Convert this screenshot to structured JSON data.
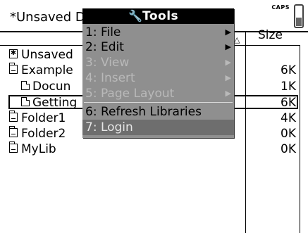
{
  "window": {
    "doc_title": "*Unsaved D",
    "caps_indicator": "CAPS"
  },
  "columns": {
    "size_header": "Size",
    "sort_indicator": "△"
  },
  "files": [
    {
      "name": "Unsaved",
      "size": "",
      "icon": "unsaved-doc-icon"
    },
    {
      "name": "Example",
      "size": "6K",
      "icon": "folder-open-icon"
    },
    {
      "name": "Docun",
      "size": "1K",
      "icon": "document-icon"
    },
    {
      "name": "Getting",
      "size": "6K",
      "icon": "document-icon"
    },
    {
      "name": "Folder1",
      "size": "4K",
      "icon": "folder-icon"
    },
    {
      "name": "Folder2",
      "size": "0K",
      "icon": "folder-icon"
    },
    {
      "name": "MyLib",
      "size": "0K",
      "icon": "folder-icon"
    }
  ],
  "menu": {
    "title": "Tools",
    "title_icon": "wrench-icon",
    "items": [
      {
        "label": "1: File",
        "enabled": true,
        "submenu": true
      },
      {
        "label": "2: Edit",
        "enabled": true,
        "submenu": true
      },
      {
        "label": "3: View",
        "enabled": false,
        "submenu": true
      },
      {
        "label": "4: Insert",
        "enabled": false,
        "submenu": true
      },
      {
        "label": "5: Page Layout",
        "enabled": false,
        "submenu": true
      },
      {
        "label": "6: Refresh Libraries",
        "enabled": true,
        "submenu": false
      },
      {
        "label": "7: Login",
        "enabled": true,
        "submenu": false,
        "highlighted": true
      }
    ]
  },
  "colors": {
    "menu_bg": "#8f8f8f",
    "menu_highlight": "#6e6e6e",
    "menu_disabled_text": "#b9b9b9",
    "title_bg": "#000000"
  }
}
